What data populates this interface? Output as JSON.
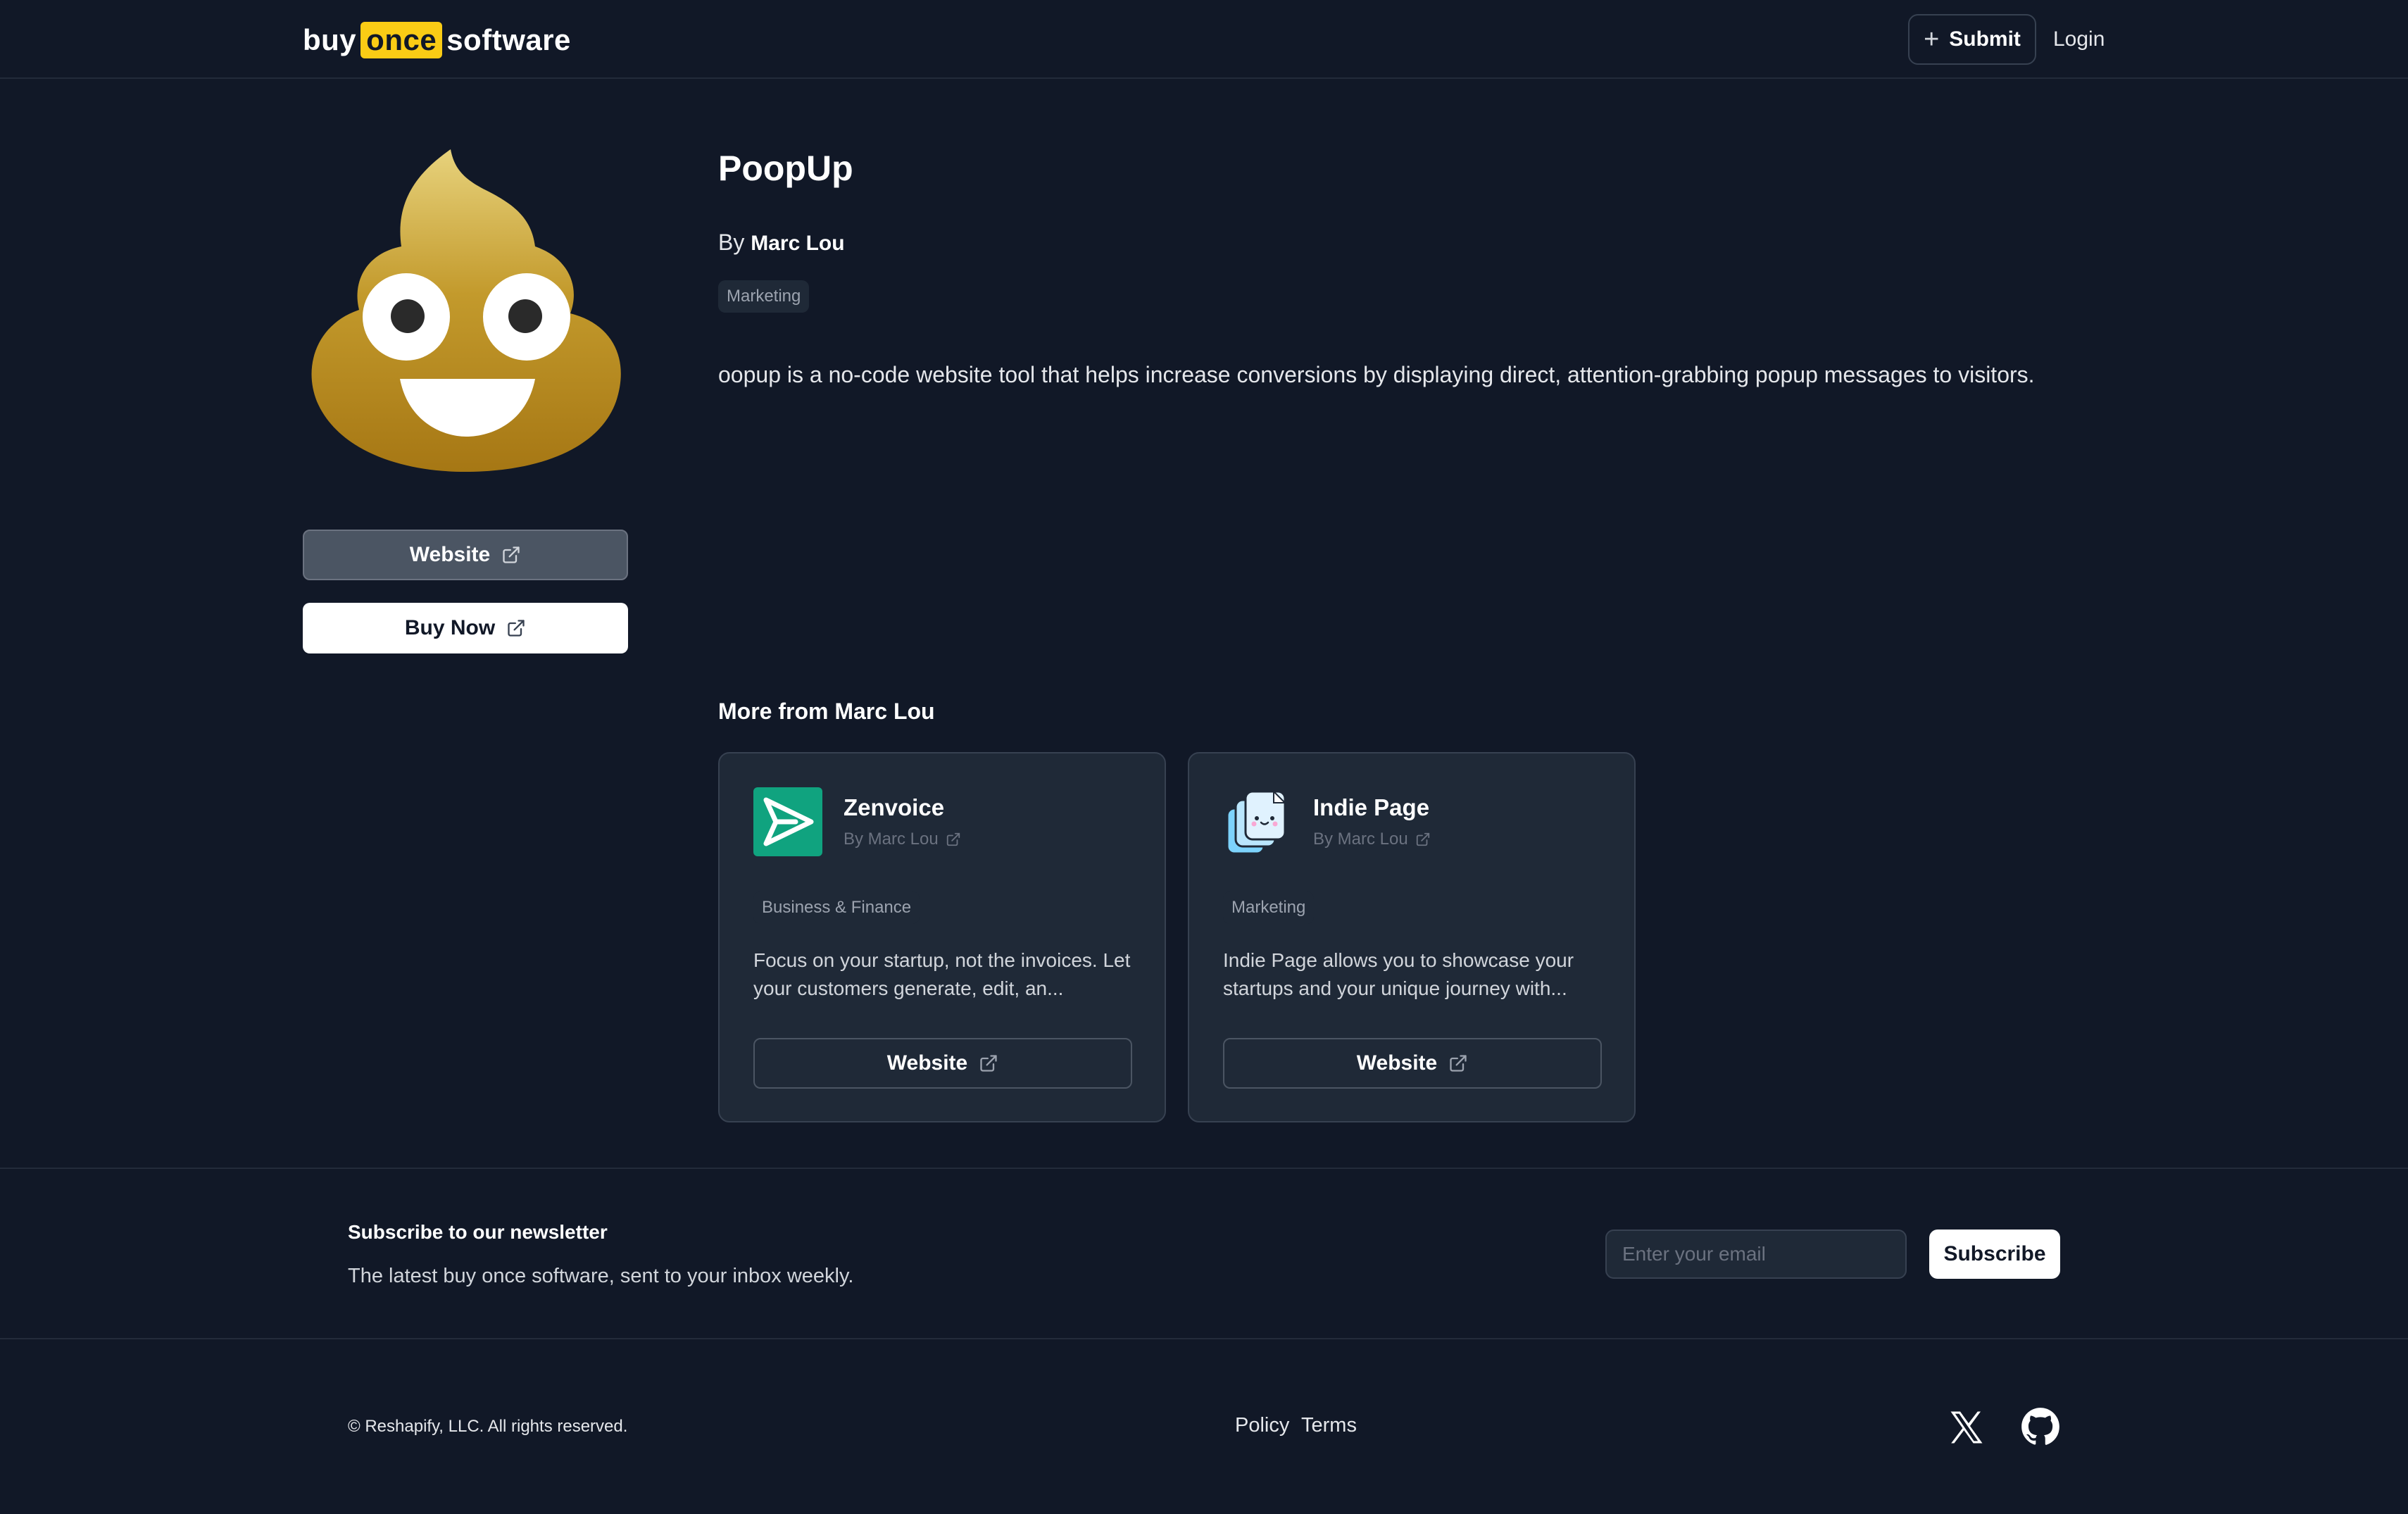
{
  "header": {
    "logo": {
      "part1": "buy",
      "part2": "once",
      "part3": "software"
    },
    "submit_label": "Submit",
    "login_label": "Login"
  },
  "product": {
    "icon": "poop-emoji-icon",
    "title": "PoopUp",
    "by_prefix": "By",
    "author": "Marc Lou",
    "tag": "Marketing",
    "description": "oopup is a no-code website tool that helps increase conversions by displaying direct, attention-grabbing popup messages to visitors.",
    "website_label": "Website",
    "buy_label": "Buy Now"
  },
  "more": {
    "heading": "More from Marc Lou",
    "cards": [
      {
        "icon": "paper-plane-icon",
        "name": "Zenvoice",
        "by": "By Marc Lou",
        "tag": "Business & Finance",
        "description": "Focus on your startup, not the invoices. Let your customers generate, edit, an...",
        "button_label": "Website"
      },
      {
        "icon": "stacked-pages-icon",
        "name": "Indie Page",
        "by": "By Marc Lou",
        "tag": "Marketing",
        "description": "Indie Page allows you to showcase your startups and your unique journey with...",
        "button_label": "Website"
      }
    ]
  },
  "newsletter": {
    "title": "Subscribe to our newsletter",
    "subtitle": "The latest buy once software, sent to your inbox weekly.",
    "email_placeholder": "Enter your email",
    "subscribe_label": "Subscribe"
  },
  "footer": {
    "copyright": "© Reshapify, LLC. All rights reserved.",
    "policy_label": "Policy",
    "terms_label": "Terms",
    "social_icons": [
      "x-logo-icon",
      "github-icon"
    ]
  },
  "colors": {
    "background": "#111827",
    "card": "#1f2937",
    "accent": "#facc15",
    "zenvoice_green": "#10a37f"
  }
}
